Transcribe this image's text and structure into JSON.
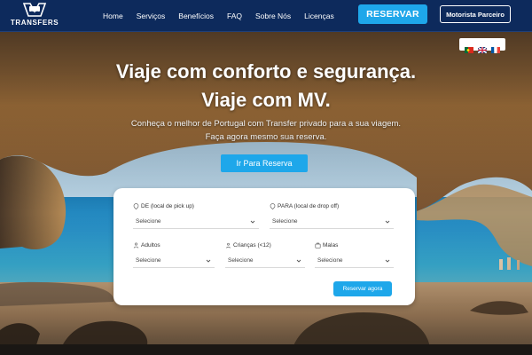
{
  "brand": {
    "name": "TRANSFERS",
    "accent": "#1ea7ea",
    "navbar_color": "#0d2a5c"
  },
  "nav": {
    "links": [
      "Home",
      "Serviços",
      "Benefícios",
      "FAQ",
      "Sobre Nós",
      "Licenças"
    ],
    "reservar_label": "RESERVAR",
    "parceiro_label": "Motorista Parceiro"
  },
  "languages": [
    {
      "icon": "portugal-flag-icon"
    },
    {
      "icon": "uk-flag-icon"
    },
    {
      "icon": "france-flag-icon"
    }
  ],
  "hero": {
    "title_line1": "Viaje com conforto e segurança.",
    "title_line2": "Viaje com MV.",
    "subtitle_line1": "Conheça o melhor de Portugal com Transfer privado para a sua viagem.",
    "subtitle_line2": "Faça agora mesmo sua reserva.",
    "cta_label": "Ir Para Reserva"
  },
  "booking": {
    "from": {
      "label": "DE (local de pick up)",
      "value": "Selecione",
      "icon": "map-pin-icon"
    },
    "to": {
      "label": "PARA (local de drop off)",
      "value": "Selecione",
      "icon": "map-pin-icon"
    },
    "adults": {
      "label": "Adultos",
      "value": "Selecione",
      "icon": "person-icon"
    },
    "children": {
      "label": "Crianças (<12)",
      "value": "Selecione",
      "icon": "child-icon"
    },
    "bags": {
      "label": "Malas",
      "value": "Selecione",
      "icon": "suitcase-icon"
    },
    "submit_label": "Reservar agora"
  }
}
